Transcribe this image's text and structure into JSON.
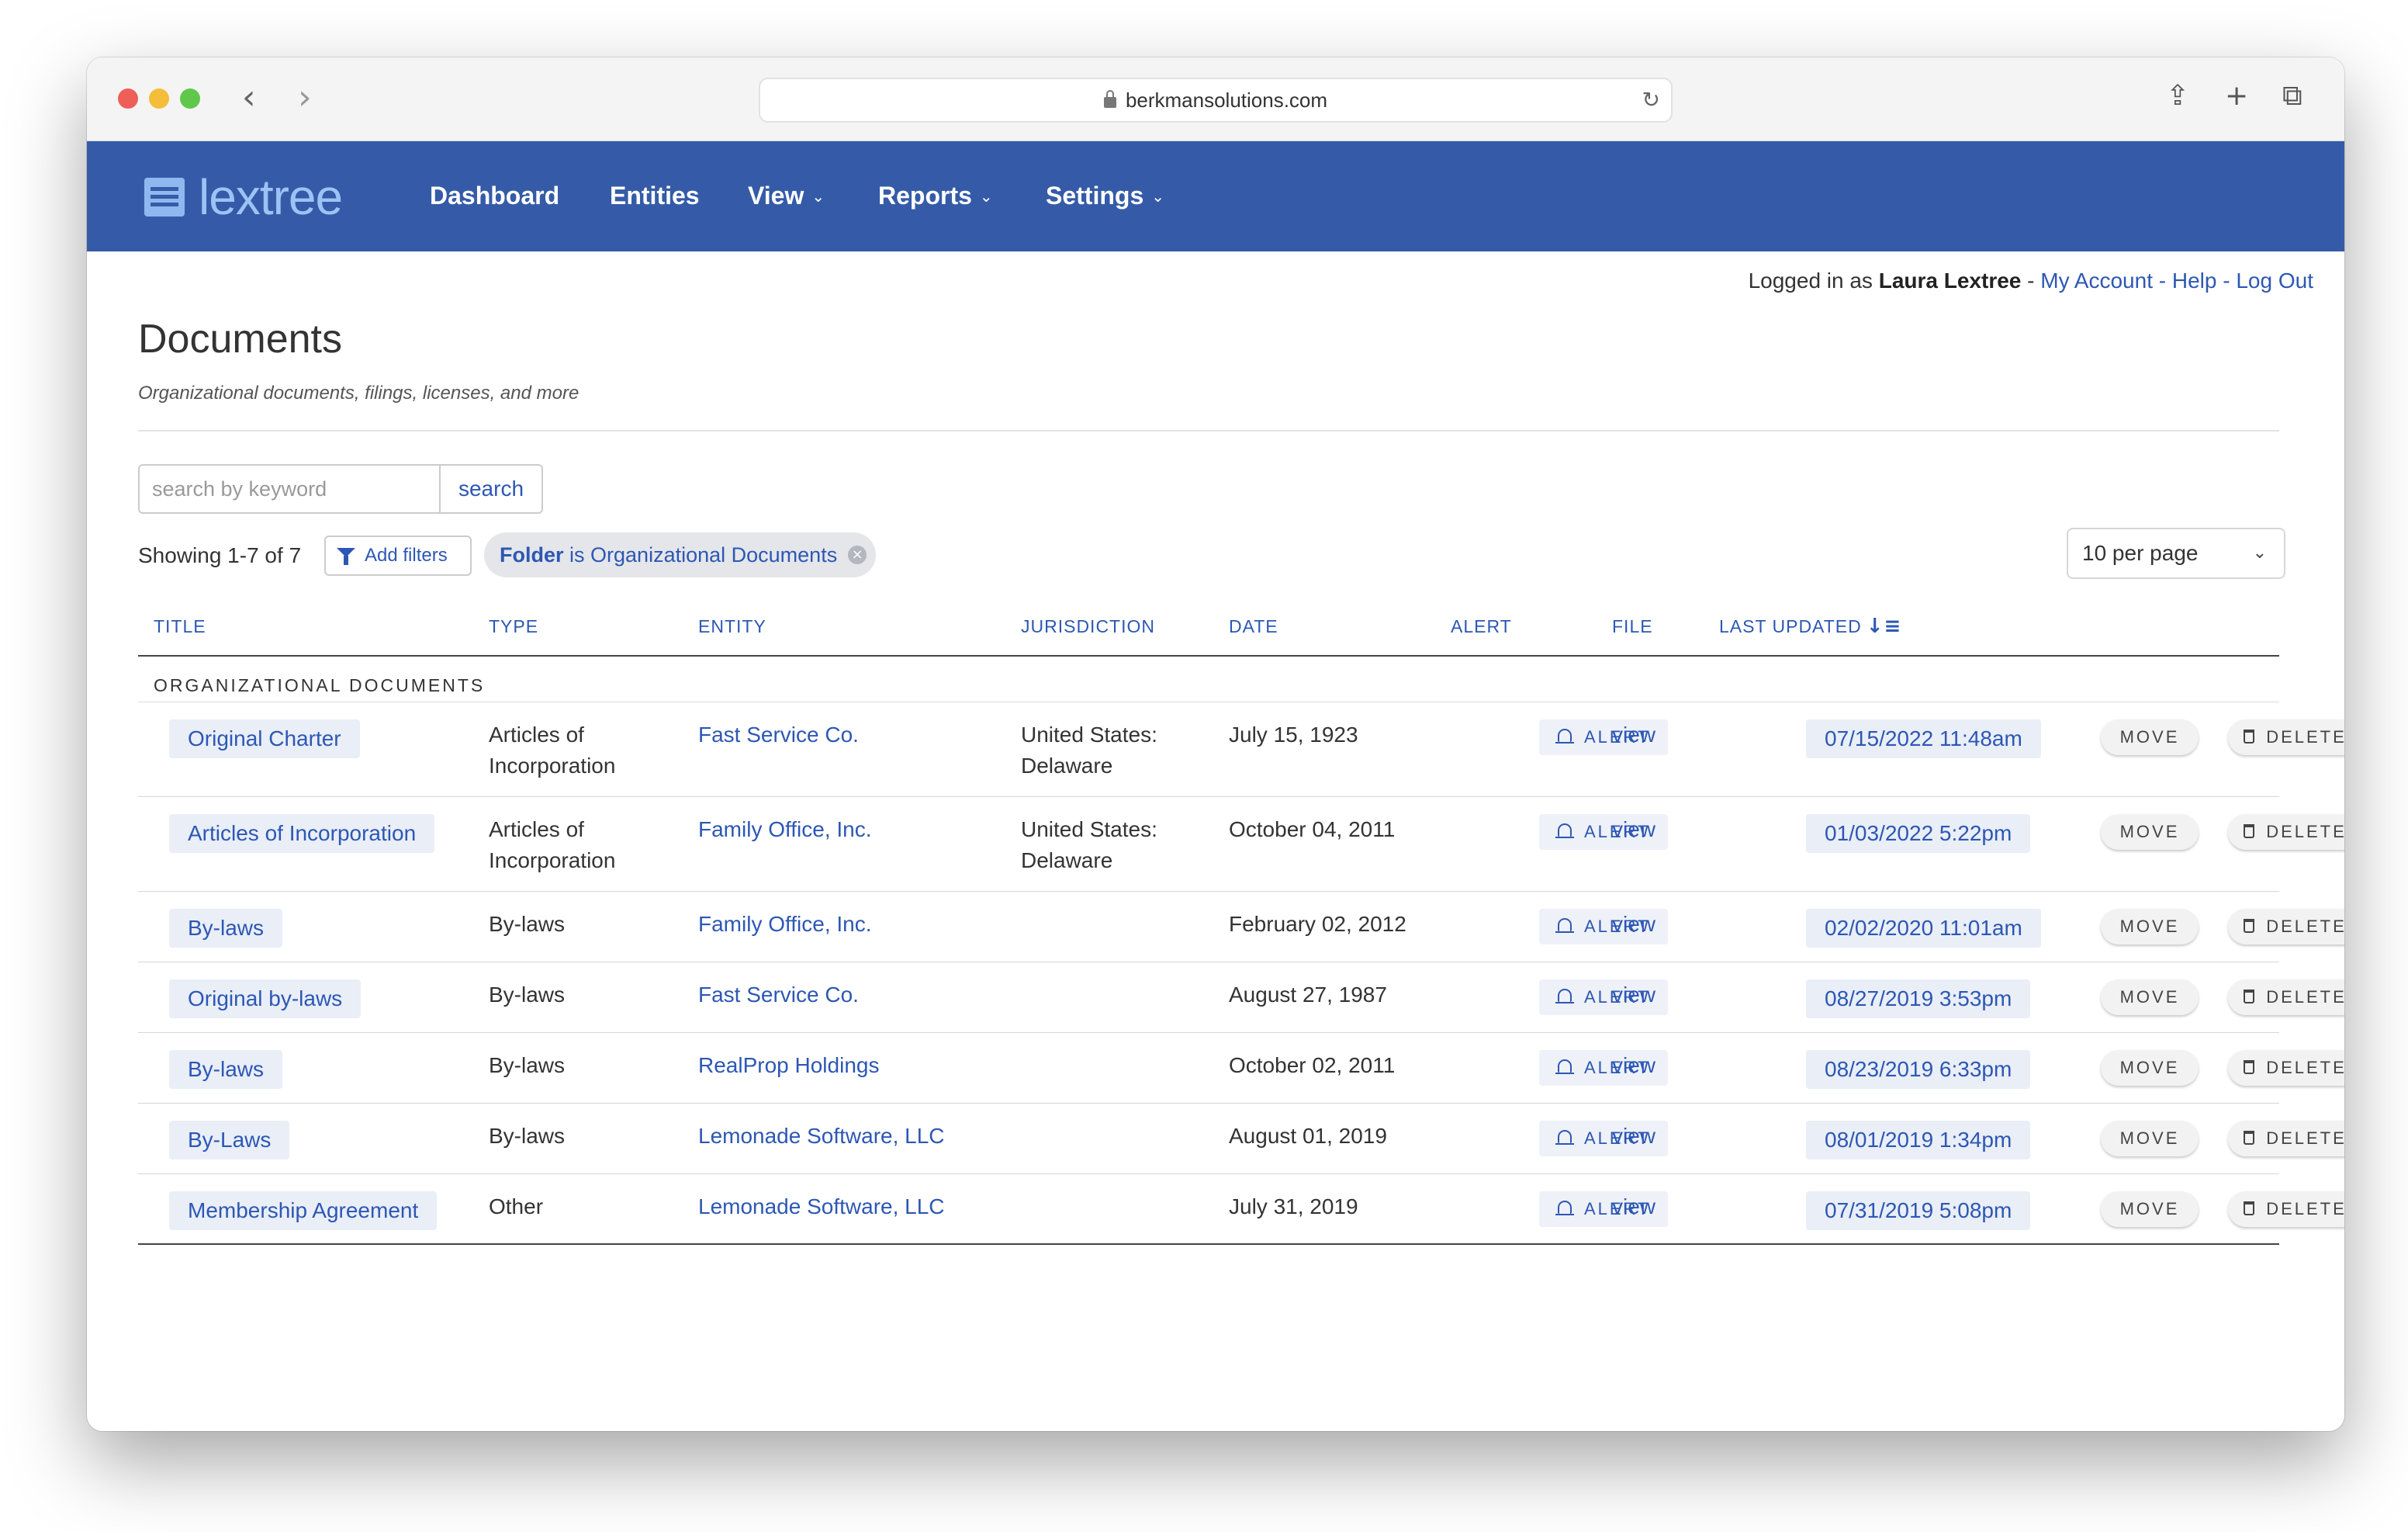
{
  "browser": {
    "url": "berkmansolutions.com",
    "back_icon": "chevron-left-icon",
    "forward_icon": "chevron-right-icon"
  },
  "app": {
    "logo_text": "lextree",
    "nav": [
      {
        "label": "Dashboard"
      },
      {
        "label": "Entities"
      },
      {
        "label": "View"
      },
      {
        "label": "Reports"
      },
      {
        "label": "Settings"
      }
    ],
    "accent_color": "#355ba8"
  },
  "user_bar": {
    "prefix": "Logged in as",
    "name": "Laura Lextree",
    "sep": "-",
    "my_account": "My Account",
    "help": "Help",
    "logout": "Log Out"
  },
  "page": {
    "title": "Documents",
    "subtitle": "Organizational documents, filings, licenses, and more"
  },
  "search": {
    "placeholder": "search by keyword",
    "button": "search"
  },
  "filters": {
    "showing": "Showing 1-7 of 7",
    "add_filters": "Add filters",
    "chip_field": "Folder",
    "chip_rest": "is Organizational Documents",
    "per_page": "10 per page"
  },
  "table": {
    "headers": [
      "TITLE",
      "TYPE",
      "ENTITY",
      "JURISDICTION",
      "DATE",
      "ALERT",
      "FILE",
      "LAST UPDATED"
    ],
    "group": "ORGANIZATIONAL DOCUMENTS",
    "alert_label": "ALERT",
    "file_label": "view",
    "move_label": "MOVE",
    "delete_label": "DELETE",
    "rows": [
      {
        "title": "Original Charter",
        "type": [
          "Articles of",
          "Incorporation"
        ],
        "entity": "Fast Service Co.",
        "jurisdiction": [
          "United States:",
          "Delaware"
        ],
        "date": "July 15, 1923",
        "updated": "07/15/2022 11:48am"
      },
      {
        "title": "Articles of Incorporation",
        "type": [
          "Articles of",
          "Incorporation"
        ],
        "entity": "Family Office, Inc.",
        "jurisdiction": [
          "United States:",
          "Delaware"
        ],
        "date": "October 04, 2011",
        "updated": "01/03/2022 5:22pm"
      },
      {
        "title": "By-laws",
        "type": [
          "By-laws"
        ],
        "entity": "Family Office, Inc.",
        "jurisdiction": [],
        "date": "February 02, 2012",
        "updated": "02/02/2020 11:01am"
      },
      {
        "title": "Original by-laws",
        "type": [
          "By-laws"
        ],
        "entity": "Fast Service Co.",
        "jurisdiction": [],
        "date": "August 27, 1987",
        "updated": "08/27/2019 3:53pm"
      },
      {
        "title": "By-laws",
        "type": [
          "By-laws"
        ],
        "entity": "RealProp Holdings",
        "jurisdiction": [],
        "date": "October 02, 2011",
        "updated": "08/23/2019 6:33pm"
      },
      {
        "title": "By-Laws",
        "type": [
          "By-laws"
        ],
        "entity": "Lemonade Software, LLC",
        "jurisdiction": [],
        "date": "August 01, 2019",
        "updated": "08/01/2019 1:34pm"
      },
      {
        "title": "Membership Agreement",
        "type": [
          "Other"
        ],
        "entity": "Lemonade Software, LLC",
        "jurisdiction": [],
        "date": "July 31, 2019",
        "updated": "07/31/2019 5:08pm"
      }
    ]
  }
}
